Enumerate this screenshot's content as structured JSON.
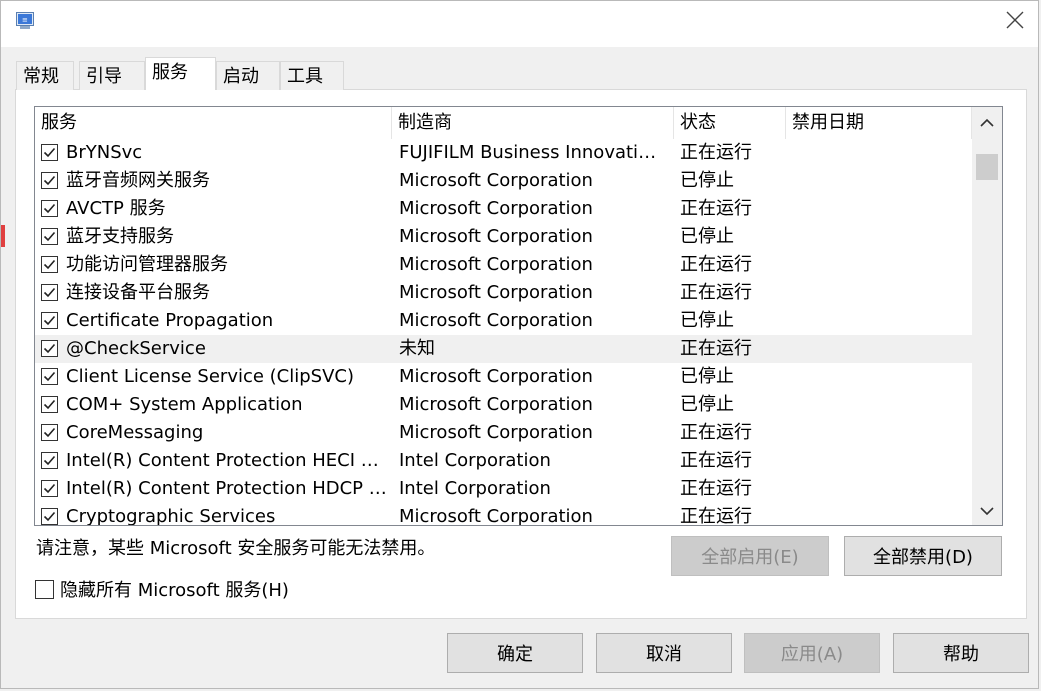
{
  "window": {
    "tabs": [
      "常规",
      "引导",
      "服务",
      "启动",
      "工具"
    ],
    "active_tab": 2
  },
  "list": {
    "columns": [
      "服务",
      "制造商",
      "状态",
      "禁用日期"
    ],
    "rows": [
      {
        "name": "BrYNSvc",
        "manufacturer": "FUJIFILM Business Innovation ...",
        "status": "正在运行",
        "disabled_date": "",
        "checked": true
      },
      {
        "name": "蓝牙音频网关服务",
        "manufacturer": "Microsoft Corporation",
        "status": "已停止",
        "disabled_date": "",
        "checked": true
      },
      {
        "name": "AVCTP 服务",
        "manufacturer": "Microsoft Corporation",
        "status": "正在运行",
        "disabled_date": "",
        "checked": true
      },
      {
        "name": "蓝牙支持服务",
        "manufacturer": "Microsoft Corporation",
        "status": "已停止",
        "disabled_date": "",
        "checked": true
      },
      {
        "name": "功能访问管理器服务",
        "manufacturer": "Microsoft Corporation",
        "status": "正在运行",
        "disabled_date": "",
        "checked": true
      },
      {
        "name": "连接设备平台服务",
        "manufacturer": "Microsoft Corporation",
        "status": "正在运行",
        "disabled_date": "",
        "checked": true
      },
      {
        "name": "Certificate Propagation",
        "manufacturer": "Microsoft Corporation",
        "status": "已停止",
        "disabled_date": "",
        "checked": true
      },
      {
        "name": "@CheckService",
        "manufacturer": "未知",
        "status": "正在运行",
        "disabled_date": "",
        "checked": true
      },
      {
        "name": "Client License Service (ClipSVC)",
        "manufacturer": "Microsoft Corporation",
        "status": "已停止",
        "disabled_date": "",
        "checked": true
      },
      {
        "name": "COM+ System Application",
        "manufacturer": "Microsoft Corporation",
        "status": "已停止",
        "disabled_date": "",
        "checked": true
      },
      {
        "name": "CoreMessaging",
        "manufacturer": "Microsoft Corporation",
        "status": "正在运行",
        "disabled_date": "",
        "checked": true
      },
      {
        "name": "Intel(R) Content Protection HECI Ser...",
        "manufacturer": "Intel Corporation",
        "status": "正在运行",
        "disabled_date": "",
        "checked": true
      },
      {
        "name": "Intel(R) Content Protection HDCP Se...",
        "manufacturer": "Intel Corporation",
        "status": "正在运行",
        "disabled_date": "",
        "checked": true
      },
      {
        "name": "Cryptographic Services",
        "manufacturer": "Microsoft Corporation",
        "status": "正在运行",
        "disabled_date": "",
        "checked": true
      }
    ],
    "hover_row": 7
  },
  "note": "请注意，某些 Microsoft 安全服务可能无法禁用。",
  "buttons": {
    "enable_all": "全部启用(E)",
    "disable_all": "全部禁用(D)",
    "ok": "确定",
    "cancel": "取消",
    "apply": "应用(A)",
    "help": "帮助"
  },
  "hide_ms_label": "隐藏所有 Microsoft 服务(H)",
  "hide_ms_checked": false,
  "colors": {
    "disabled_button": "#cccccc",
    "hover_row": "#f0f0f0"
  },
  "icons": {
    "app": "msconfig-icon",
    "close": "close-icon",
    "scroll_up": "chevron-up-icon",
    "scroll_down": "chevron-down-icon"
  }
}
